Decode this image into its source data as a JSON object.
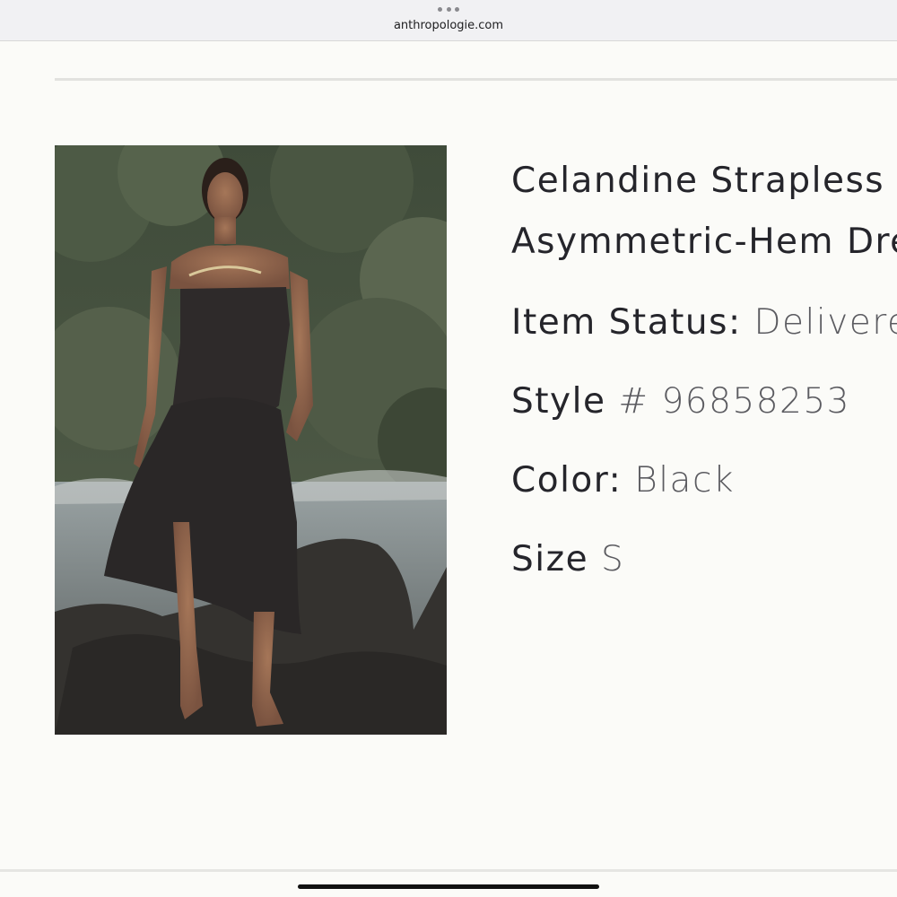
{
  "browser": {
    "url": "anthropologie.com"
  },
  "product": {
    "image_alt": "Model wearing black strapless asymmetric-hem dress on rocks by the sea",
    "title_line1": "Celandine Strapless",
    "title_line2": "Asymmetric-Hem Dress",
    "status_label": "Item Status:",
    "status_value": "Delivered",
    "style_label": "Style",
    "style_value": "# 96858253",
    "color_label": "Color:",
    "color_value": "Black",
    "size_label": "Size",
    "size_value": "S"
  },
  "colors": {
    "background": "#fbfbf8",
    "text": "#25252b",
    "muted": "#5b5b60"
  }
}
